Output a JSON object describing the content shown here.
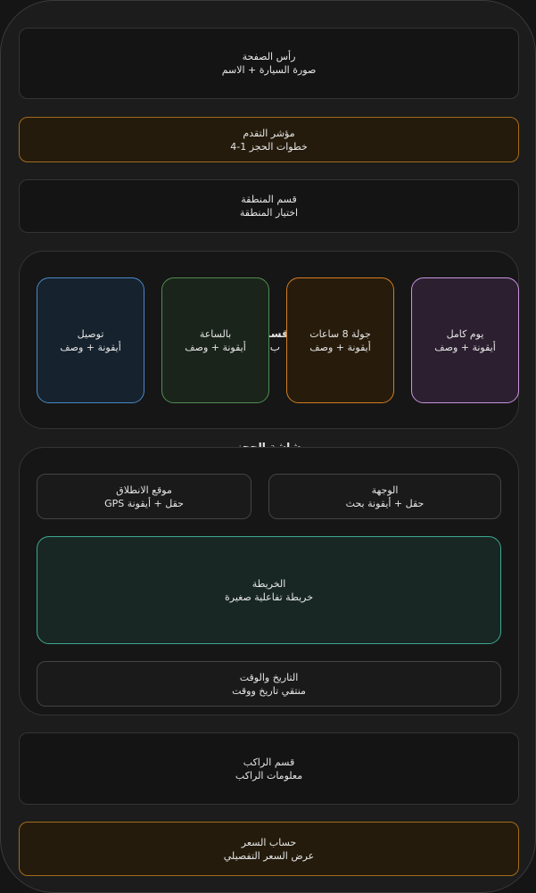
{
  "header": {
    "title": "رأس الصفحة",
    "subtitle": "صورة السيارة + الاسم"
  },
  "progress": {
    "title": "مؤشر التقدم",
    "subtitle": "خطوات الحجز 1-4"
  },
  "zone": {
    "title": "قسم المنطقة",
    "subtitle": "اختيار المنطقة"
  },
  "service_section": {
    "ghost_title": "قسم ا",
    "ghost_subtitle": "ب أنو",
    "cards": [
      {
        "title": "يوم كامل",
        "subtitle": "أيقونة + وصف",
        "color": "#c993e0"
      },
      {
        "title": "جولة 8 ساعات",
        "subtitle": "أيقونة + وصف",
        "color": "#d27d21"
      },
      {
        "title": "بالساعة",
        "subtitle": "أيقونة + وصف",
        "color": "#4f8d50"
      },
      {
        "title": "توصيل",
        "subtitle": "أيقونة + وصف",
        "color": "#4a88c9"
      }
    ]
  },
  "trip_section": {
    "ghost_title": "شاشة الحجز",
    "destination": {
      "title": "الوجهة",
      "subtitle": "حقل + أيقونة بحث"
    },
    "pickup": {
      "title": "موقع الانطلاق",
      "subtitle": "حقل + أيقونة GPS"
    },
    "map": {
      "title": "الخريطة",
      "subtitle": "خريطة تفاعلية صغيرة",
      "color": "#3ea88f"
    },
    "datetime": {
      "title": "التاريخ والوقت",
      "subtitle": "منتقي تاريخ ووقت"
    }
  },
  "passenger": {
    "title": "قسم الراكب",
    "subtitle": "معلومات الراكب"
  },
  "price": {
    "title": "حساب السعر",
    "subtitle": "عرض السعر التفصيلي"
  }
}
